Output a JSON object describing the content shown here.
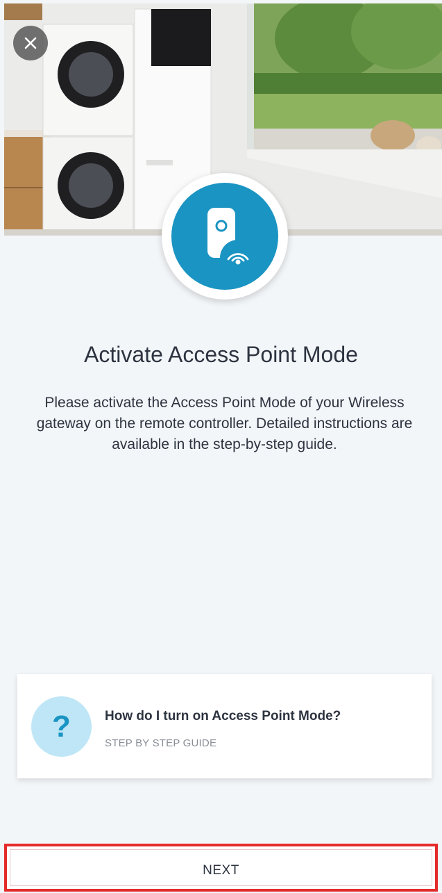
{
  "screen": {
    "title": "Activate Access Point Mode",
    "description": "Please activate the Access Point Mode of your Wireless gateway on the remote controller. Detailed instructions are available in the step-by-step guide."
  },
  "hero": {
    "icon": "device-wifi-icon",
    "accent_color": "#1a94c2"
  },
  "close": {
    "icon": "close-icon"
  },
  "guide": {
    "title": "How do I turn on Access Point Mode?",
    "subtitle": "STEP BY STEP GUIDE",
    "icon_glyph": "?",
    "icon": "question-mark-icon"
  },
  "footer": {
    "next_label": "NEXT",
    "highlight_color": "#e52a2a"
  }
}
